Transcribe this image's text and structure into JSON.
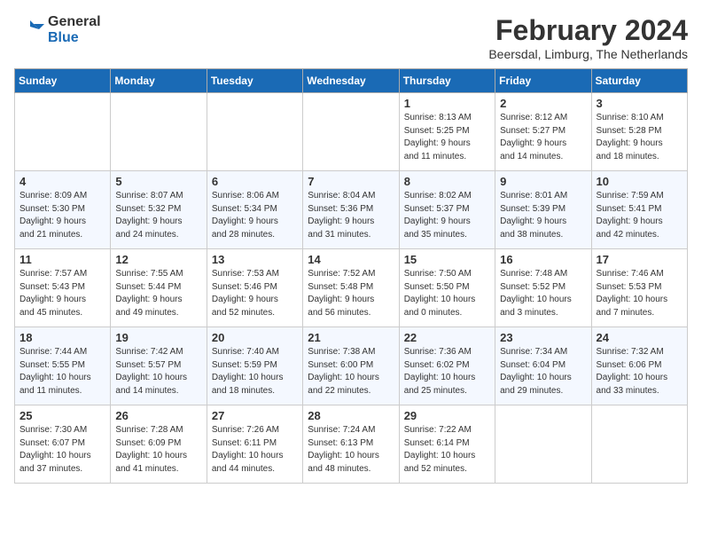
{
  "logo": {
    "line1": "General",
    "line2": "Blue"
  },
  "title": "February 2024",
  "subtitle": "Beersdal, Limburg, The Netherlands",
  "days_of_week": [
    "Sunday",
    "Monday",
    "Tuesday",
    "Wednesday",
    "Thursday",
    "Friday",
    "Saturday"
  ],
  "weeks": [
    [
      {
        "day": "",
        "info": ""
      },
      {
        "day": "",
        "info": ""
      },
      {
        "day": "",
        "info": ""
      },
      {
        "day": "",
        "info": ""
      },
      {
        "day": "1",
        "info": "Sunrise: 8:13 AM\nSunset: 5:25 PM\nDaylight: 9 hours\nand 11 minutes."
      },
      {
        "day": "2",
        "info": "Sunrise: 8:12 AM\nSunset: 5:27 PM\nDaylight: 9 hours\nand 14 minutes."
      },
      {
        "day": "3",
        "info": "Sunrise: 8:10 AM\nSunset: 5:28 PM\nDaylight: 9 hours\nand 18 minutes."
      }
    ],
    [
      {
        "day": "4",
        "info": "Sunrise: 8:09 AM\nSunset: 5:30 PM\nDaylight: 9 hours\nand 21 minutes."
      },
      {
        "day": "5",
        "info": "Sunrise: 8:07 AM\nSunset: 5:32 PM\nDaylight: 9 hours\nand 24 minutes."
      },
      {
        "day": "6",
        "info": "Sunrise: 8:06 AM\nSunset: 5:34 PM\nDaylight: 9 hours\nand 28 minutes."
      },
      {
        "day": "7",
        "info": "Sunrise: 8:04 AM\nSunset: 5:36 PM\nDaylight: 9 hours\nand 31 minutes."
      },
      {
        "day": "8",
        "info": "Sunrise: 8:02 AM\nSunset: 5:37 PM\nDaylight: 9 hours\nand 35 minutes."
      },
      {
        "day": "9",
        "info": "Sunrise: 8:01 AM\nSunset: 5:39 PM\nDaylight: 9 hours\nand 38 minutes."
      },
      {
        "day": "10",
        "info": "Sunrise: 7:59 AM\nSunset: 5:41 PM\nDaylight: 9 hours\nand 42 minutes."
      }
    ],
    [
      {
        "day": "11",
        "info": "Sunrise: 7:57 AM\nSunset: 5:43 PM\nDaylight: 9 hours\nand 45 minutes."
      },
      {
        "day": "12",
        "info": "Sunrise: 7:55 AM\nSunset: 5:44 PM\nDaylight: 9 hours\nand 49 minutes."
      },
      {
        "day": "13",
        "info": "Sunrise: 7:53 AM\nSunset: 5:46 PM\nDaylight: 9 hours\nand 52 minutes."
      },
      {
        "day": "14",
        "info": "Sunrise: 7:52 AM\nSunset: 5:48 PM\nDaylight: 9 hours\nand 56 minutes."
      },
      {
        "day": "15",
        "info": "Sunrise: 7:50 AM\nSunset: 5:50 PM\nDaylight: 10 hours\nand 0 minutes."
      },
      {
        "day": "16",
        "info": "Sunrise: 7:48 AM\nSunset: 5:52 PM\nDaylight: 10 hours\nand 3 minutes."
      },
      {
        "day": "17",
        "info": "Sunrise: 7:46 AM\nSunset: 5:53 PM\nDaylight: 10 hours\nand 7 minutes."
      }
    ],
    [
      {
        "day": "18",
        "info": "Sunrise: 7:44 AM\nSunset: 5:55 PM\nDaylight: 10 hours\nand 11 minutes."
      },
      {
        "day": "19",
        "info": "Sunrise: 7:42 AM\nSunset: 5:57 PM\nDaylight: 10 hours\nand 14 minutes."
      },
      {
        "day": "20",
        "info": "Sunrise: 7:40 AM\nSunset: 5:59 PM\nDaylight: 10 hours\nand 18 minutes."
      },
      {
        "day": "21",
        "info": "Sunrise: 7:38 AM\nSunset: 6:00 PM\nDaylight: 10 hours\nand 22 minutes."
      },
      {
        "day": "22",
        "info": "Sunrise: 7:36 AM\nSunset: 6:02 PM\nDaylight: 10 hours\nand 25 minutes."
      },
      {
        "day": "23",
        "info": "Sunrise: 7:34 AM\nSunset: 6:04 PM\nDaylight: 10 hours\nand 29 minutes."
      },
      {
        "day": "24",
        "info": "Sunrise: 7:32 AM\nSunset: 6:06 PM\nDaylight: 10 hours\nand 33 minutes."
      }
    ],
    [
      {
        "day": "25",
        "info": "Sunrise: 7:30 AM\nSunset: 6:07 PM\nDaylight: 10 hours\nand 37 minutes."
      },
      {
        "day": "26",
        "info": "Sunrise: 7:28 AM\nSunset: 6:09 PM\nDaylight: 10 hours\nand 41 minutes."
      },
      {
        "day": "27",
        "info": "Sunrise: 7:26 AM\nSunset: 6:11 PM\nDaylight: 10 hours\nand 44 minutes."
      },
      {
        "day": "28",
        "info": "Sunrise: 7:24 AM\nSunset: 6:13 PM\nDaylight: 10 hours\nand 48 minutes."
      },
      {
        "day": "29",
        "info": "Sunrise: 7:22 AM\nSunset: 6:14 PM\nDaylight: 10 hours\nand 52 minutes."
      },
      {
        "day": "",
        "info": ""
      },
      {
        "day": "",
        "info": ""
      }
    ]
  ]
}
